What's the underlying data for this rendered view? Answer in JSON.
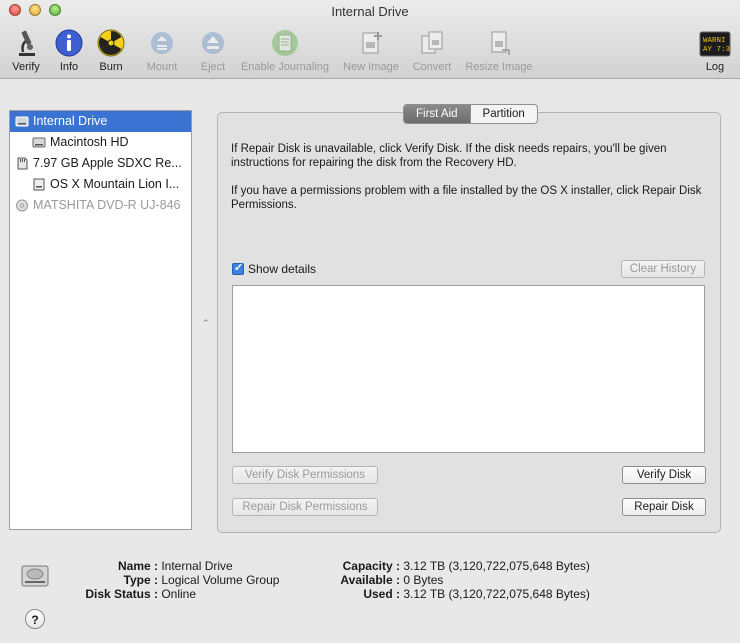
{
  "window": {
    "title": "Internal Drive"
  },
  "toolbar": {
    "verify": "Verify",
    "info": "Info",
    "burn": "Burn",
    "mount": "Mount",
    "eject": "Eject",
    "enable_journaling": "Enable Journaling",
    "new_image": "New Image",
    "convert": "Convert",
    "resize_image": "Resize Image",
    "log": "Log",
    "log_icon_text1": "WARNI",
    "log_icon_text2": "AY 7:36"
  },
  "sidebar": {
    "items": [
      {
        "label": "Internal Drive"
      },
      {
        "label": "Macintosh HD"
      },
      {
        "label": "7.97 GB Apple SDXC Re..."
      },
      {
        "label": "OS X Mountain Lion I..."
      },
      {
        "label": "MATSHITA DVD-R UJ-846"
      }
    ]
  },
  "tabs": {
    "first_aid": "First Aid",
    "partition": "Partition"
  },
  "first_aid": {
    "para1": "If Repair Disk is unavailable, click Verify Disk. If the disk needs repairs, you'll be given instructions for repairing the disk from the Recovery HD.",
    "para2": "If you have a permissions problem with a file installed by the OS X installer, click Repair Disk Permissions.",
    "show_details": "Show details",
    "clear_history": "Clear History",
    "verify_permissions": "Verify Disk Permissions",
    "verify_disk": "Verify Disk",
    "repair_permissions": "Repair Disk Permissions",
    "repair_disk": "Repair Disk"
  },
  "info": {
    "name_label": "Name :",
    "name_value": "Internal Drive",
    "type_label": "Type :",
    "type_value": "Logical Volume Group",
    "status_label": "Disk Status :",
    "status_value": "Online",
    "capacity_label": "Capacity :",
    "capacity_value": "3.12 TB (3,120,722,075,648 Bytes)",
    "available_label": "Available :",
    "available_value": "0 Bytes",
    "used_label": "Used :",
    "used_value": "3.12 TB (3,120,722,075,648 Bytes)"
  },
  "help": "?"
}
